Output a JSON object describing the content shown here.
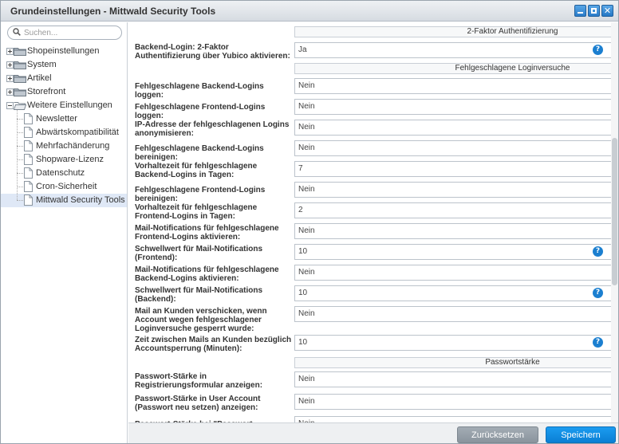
{
  "window": {
    "title": "Grundeinstellungen - Mittwald Security Tools"
  },
  "search": {
    "placeholder": "Suchen..."
  },
  "tree": [
    {
      "label": "Shopeinstellungen",
      "type": "folder",
      "level": 0,
      "expanded": false
    },
    {
      "label": "System",
      "type": "folder",
      "level": 0,
      "expanded": false
    },
    {
      "label": "Artikel",
      "type": "folder",
      "level": 0,
      "expanded": false
    },
    {
      "label": "Storefront",
      "type": "folder",
      "level": 0,
      "expanded": false
    },
    {
      "label": "Weitere Einstellungen",
      "type": "folder",
      "level": 0,
      "expanded": true
    },
    {
      "label": "Newsletter",
      "type": "file",
      "level": 1
    },
    {
      "label": "Abwärtskompatibilität",
      "type": "file",
      "level": 1
    },
    {
      "label": "Mehrfachänderung",
      "type": "file",
      "level": 1
    },
    {
      "label": "Shopware-Lizenz",
      "type": "file",
      "level": 1
    },
    {
      "label": "Datenschutz",
      "type": "file",
      "level": 1
    },
    {
      "label": "Cron-Sicherheit",
      "type": "file",
      "level": 1
    },
    {
      "label": "Mittwald Security Tools",
      "type": "file",
      "level": 1,
      "selected": true
    }
  ],
  "sections": [
    "2-Faktor Authentifizierung",
    "Fehlgeschlagene Loginversuche",
    "Passwortstärke"
  ],
  "fields": [
    {
      "label": "Backend-Login: 2-Faktor Authentifizierung über Yubico aktivieren:",
      "value": "Ja",
      "kind": "combo",
      "help": true
    },
    {
      "label": "Fehlgeschlagene Backend-Logins loggen:",
      "value": "Nein",
      "kind": "combo",
      "help": false
    },
    {
      "label": "Fehlgeschlagene Frontend-Logins loggen:",
      "value": "Nein",
      "kind": "combo",
      "help": false
    },
    {
      "label": "IP-Adresse der fehlgeschlagenen Logins anonymisieren:",
      "value": "Nein",
      "kind": "combo",
      "help": false
    },
    {
      "label": "Fehlgeschlagene Backend-Logins bereinigen:",
      "value": "Nein",
      "kind": "combo",
      "help": false
    },
    {
      "label": "Vorhaltezeit für fehlgeschlagene Backend-Logins in Tagen:",
      "value": "7",
      "kind": "spin",
      "help": false
    },
    {
      "label": "Fehlgeschlagene Frontend-Logins bereinigen:",
      "value": "Nein",
      "kind": "combo",
      "help": false
    },
    {
      "label": "Vorhaltezeit für fehlgeschlagene Frontend-Logins in Tagen:",
      "value": "2",
      "kind": "spin",
      "help": false
    },
    {
      "label": "Mail-Notifications für fehlgeschlagene Frontend-Logins aktivieren:",
      "value": "Nein",
      "kind": "combo",
      "help": false
    },
    {
      "label": "Schwellwert für Mail-Notifications (Frontend):",
      "value": "10",
      "kind": "spin",
      "help": true
    },
    {
      "label": "Mail-Notifications für fehlgeschlagene Backend-Logins aktivieren:",
      "value": "Nein",
      "kind": "combo",
      "help": false
    },
    {
      "label": "Schwellwert für Mail-Notifications (Backend):",
      "value": "10",
      "kind": "spin",
      "help": true
    },
    {
      "label": "Mail an Kunden verschicken, wenn Account wegen fehlgeschlagener Loginversuche gesperrt wurde:",
      "value": "Nein",
      "kind": "combo",
      "help": false
    },
    {
      "label": "Zeit zwischen Mails an Kunden bezüglich Accountsperrung (Minuten):",
      "value": "10",
      "kind": "spin",
      "help": true
    },
    {
      "label": "Passwort-Stärke in Registrierungsformular anzeigen:",
      "value": "Nein",
      "kind": "combo",
      "help": false
    },
    {
      "label": "Passwort-Stärke in User Account (Passwort neu setzen) anzeigen:",
      "value": "Nein",
      "kind": "combo",
      "help": false
    },
    {
      "label": "Passwort-Stärke bei \"Passwort Vergessen\"",
      "value": "Nein",
      "kind": "combo",
      "help": false
    }
  ],
  "footer": {
    "reset_label": "Zurücksetzen",
    "save_label": "Speichern"
  },
  "colors": {
    "accent": "#0a7fd4",
    "help": "#1b7fd0",
    "selection": "#dfe8f6"
  }
}
